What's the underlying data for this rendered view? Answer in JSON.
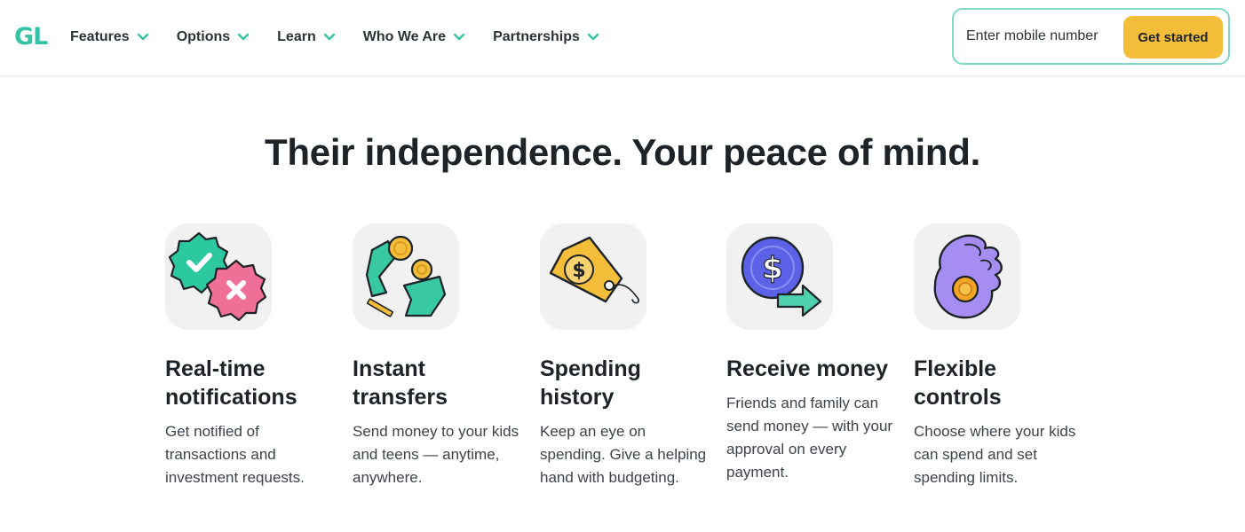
{
  "header": {
    "logo_text": "GL",
    "nav": [
      {
        "label": "Features"
      },
      {
        "label": "Options"
      },
      {
        "label": "Learn"
      },
      {
        "label": "Who We Are"
      },
      {
        "label": "Partnerships"
      }
    ],
    "cta": {
      "placeholder": "Enter mobile number",
      "button_label": "Get started"
    }
  },
  "hero": {
    "title": "Their independence. Your peace of mind."
  },
  "features": [
    {
      "icon": "approve-decline-badges-icon",
      "title": "Real-time notifications",
      "text": "Get notified of transactions and investment requests."
    },
    {
      "icon": "money-transfer-icon",
      "title": "Instant transfers",
      "text": "Send money to your kids and teens — anytime, anywhere."
    },
    {
      "icon": "price-tag-icon",
      "title": "Spending history",
      "text": "Keep an eye on spending. Give a helping hand with budgeting."
    },
    {
      "icon": "dollar-arrow-icon",
      "title": "Receive money",
      "text": "Friends and family can send money — with your approval on every payment."
    },
    {
      "icon": "hand-coin-icon",
      "title": "Flexible controls",
      "text": "Choose where your kids can spend and set spending limits."
    }
  ],
  "colors": {
    "brand_teal": "#34c3a6",
    "cta_yellow": "#f5be3a",
    "cta_border": "#7fd9c6",
    "text_dark": "#1d2327"
  }
}
